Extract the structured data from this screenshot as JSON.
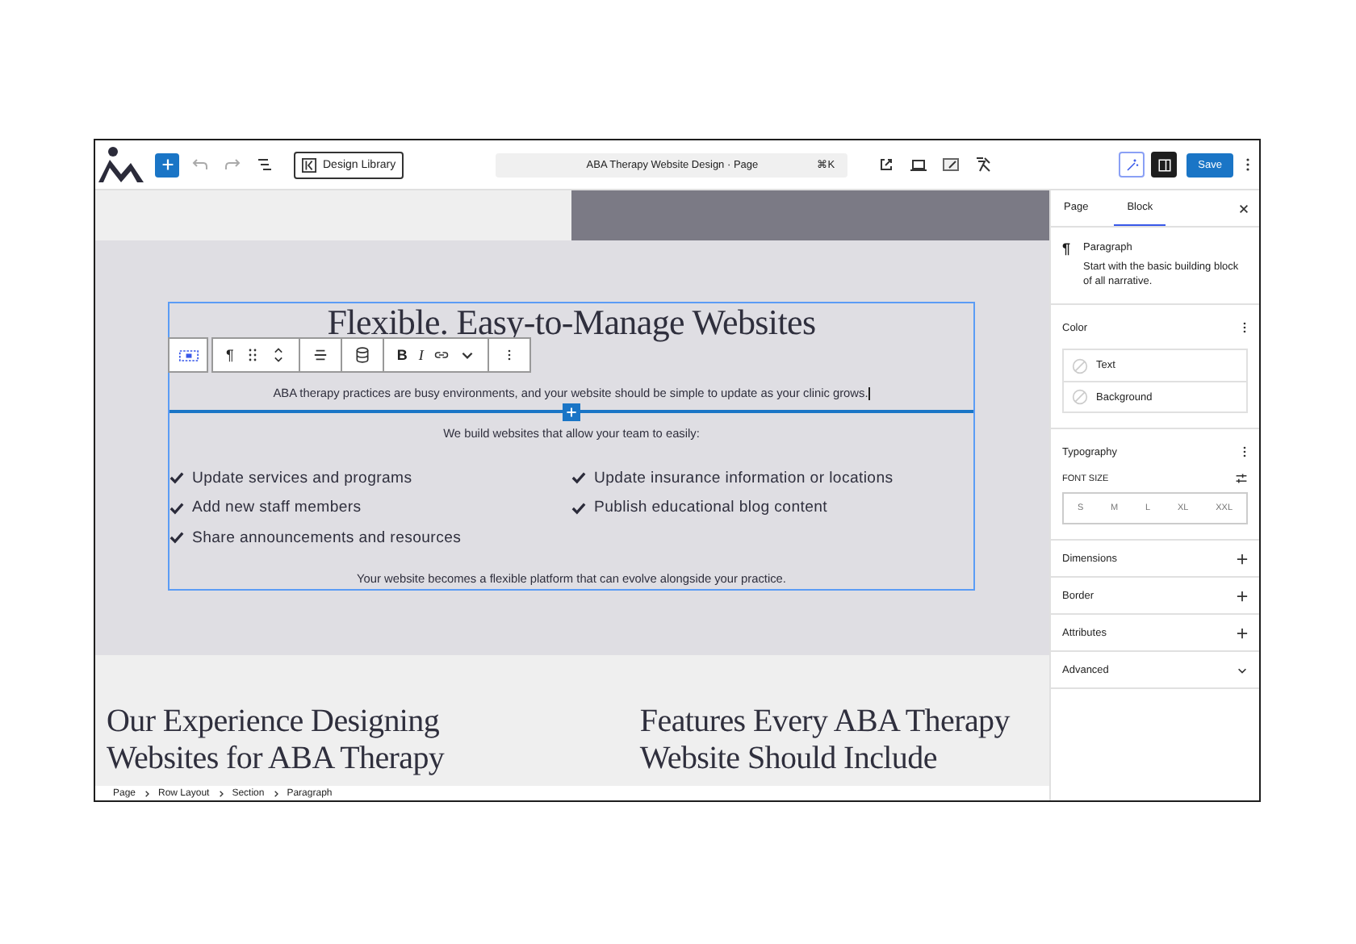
{
  "topbar": {
    "design_library": "Design Library",
    "command": {
      "title": "ABA Therapy Website Design · Page",
      "shortcut": "⌘K"
    },
    "panel_toggles": [
      {
        "kind": "styles",
        "selected": false
      },
      {
        "kind": "settings",
        "selected": true
      }
    ],
    "save": "Save"
  },
  "block_toolbar": {
    "paragraph": "¶",
    "bold": "B",
    "italic": "I"
  },
  "group": {
    "heading": "Flexible. Easy-to-Manage Websites",
    "intro": "ABA therapy practices are busy environments, and your website should be simple to update as your clinic grows.",
    "lead": "We build websites that allow your team to easily:",
    "feature_columns": [
      {
        "items": [
          "Update services and programs",
          "Add new staff members",
          "Share announcements and resources"
        ]
      },
      {
        "items": [
          "Update insurance information or locations",
          "Publish educational blog content"
        ]
      }
    ],
    "closing": "Your website becomes a flexible platform that can evolve alongside your practice."
  },
  "next_section": {
    "headings": [
      "Our Experience Designing Websites for ABA Therapy",
      "Features Every ABA Therapy Website Should Include"
    ]
  },
  "breadcrumb": [
    "Page",
    "Row Layout",
    "Section",
    "Paragraph"
  ],
  "sidebar": {
    "tabs": [
      {
        "label": "Page",
        "selected": false
      },
      {
        "label": "Block",
        "selected": true
      }
    ],
    "block": {
      "icon": "¶",
      "name": "Paragraph",
      "description": "Start with the basic building block of all narrative."
    },
    "color": {
      "title": "Color",
      "items": [
        "Text",
        "Background"
      ]
    },
    "typography": {
      "title": "Typography",
      "font_size_label": "FONT SIZE",
      "sizes": [
        {
          "label": "S",
          "selected": false
        },
        {
          "label": "M",
          "selected": false
        },
        {
          "label": "L",
          "selected": false
        },
        {
          "label": "XL",
          "selected": false
        },
        {
          "label": "XXL",
          "selected": false
        }
      ]
    },
    "panels": [
      {
        "title": "Dimensions",
        "kind": "add"
      },
      {
        "title": "Border",
        "kind": "add"
      },
      {
        "title": "Attributes",
        "kind": "add"
      },
      {
        "title": "Advanced",
        "kind": "collapse"
      }
    ]
  }
}
